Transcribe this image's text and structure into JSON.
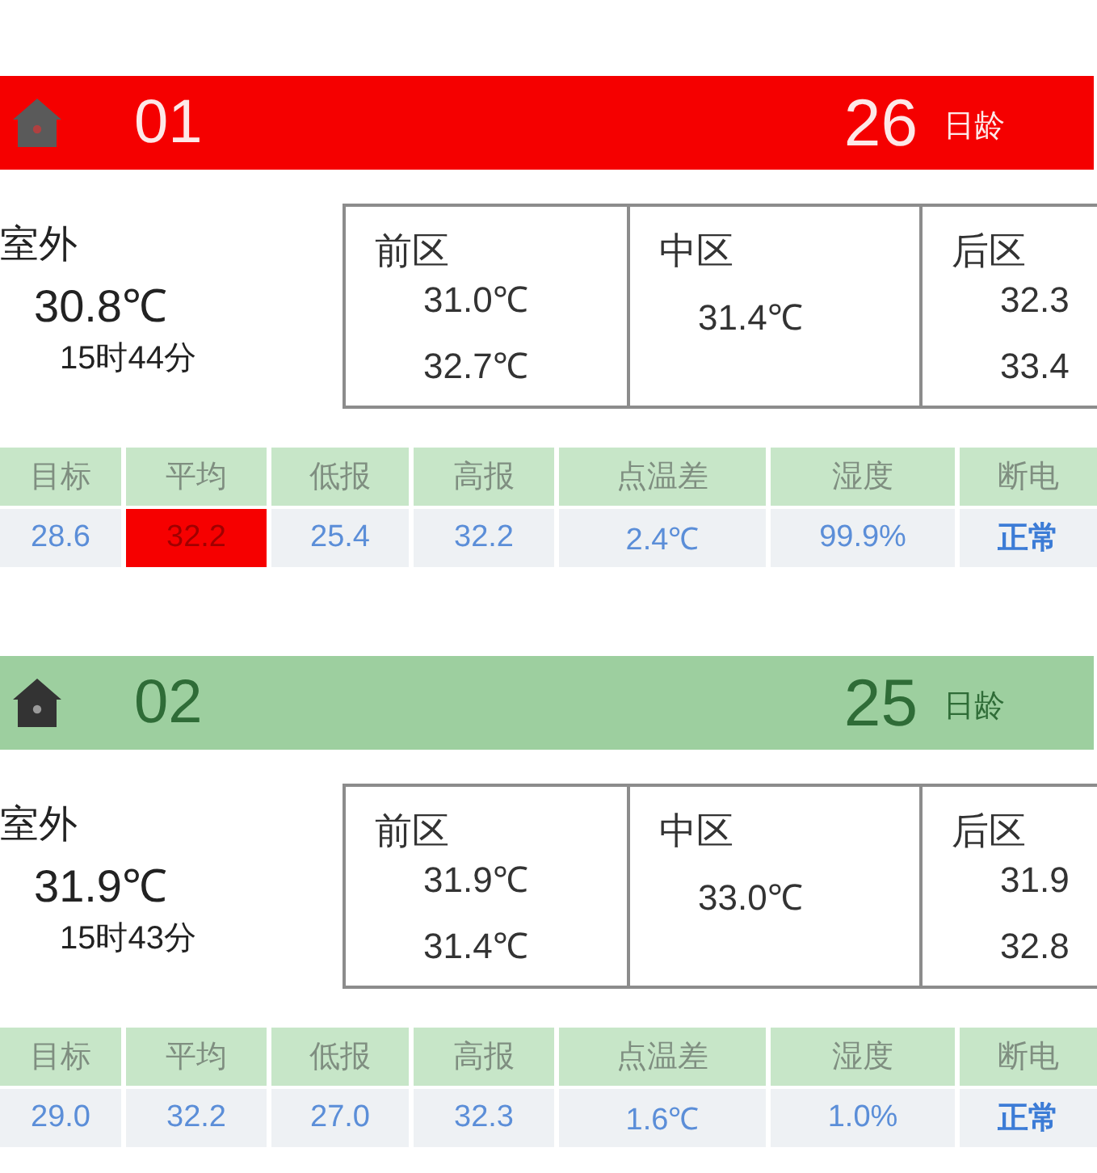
{
  "houses": [
    {
      "number": "01",
      "alarm": true,
      "age": "26",
      "age_unit": "日龄",
      "outdoor": {
        "label": "室外",
        "temperature": "30.8℃",
        "time": "15时44分"
      },
      "zones": [
        {
          "label": "前区",
          "readings": [
            "31.0℃",
            "32.7℃"
          ]
        },
        {
          "label": "中区",
          "readings": [
            "31.4℃"
          ]
        },
        {
          "label": "后区",
          "readings": [
            "32.3",
            "33.4"
          ]
        }
      ],
      "stats": [
        {
          "label": "目标",
          "value": "28.6",
          "kind": "number",
          "alarm": false
        },
        {
          "label": "平均",
          "value": "32.2",
          "kind": "number",
          "alarm": true
        },
        {
          "label": "低报",
          "value": "25.4",
          "kind": "number",
          "alarm": false
        },
        {
          "label": "高报",
          "value": "32.2",
          "kind": "number",
          "alarm": false
        },
        {
          "label": "点温差",
          "value": "2.4℃",
          "kind": "number",
          "alarm": false
        },
        {
          "label": "湿度",
          "value": "99.9%",
          "kind": "number",
          "alarm": false
        },
        {
          "label": "断电",
          "value": "正常",
          "kind": "status",
          "alarm": false
        }
      ]
    },
    {
      "number": "02",
      "alarm": false,
      "age": "25",
      "age_unit": "日龄",
      "outdoor": {
        "label": "室外",
        "temperature": "31.9℃",
        "time": "15时43分"
      },
      "zones": [
        {
          "label": "前区",
          "readings": [
            "31.9℃",
            "31.4℃"
          ]
        },
        {
          "label": "中区",
          "readings": [
            "33.0℃"
          ]
        },
        {
          "label": "后区",
          "readings": [
            "31.9",
            "32.8"
          ]
        }
      ],
      "stats": [
        {
          "label": "目标",
          "value": "29.0",
          "kind": "number",
          "alarm": false
        },
        {
          "label": "平均",
          "value": "32.2",
          "kind": "number",
          "alarm": false
        },
        {
          "label": "低报",
          "value": "27.0",
          "kind": "number",
          "alarm": false
        },
        {
          "label": "高报",
          "value": "32.3",
          "kind": "number",
          "alarm": false
        },
        {
          "label": "点温差",
          "value": "1.6℃",
          "kind": "number",
          "alarm": false
        },
        {
          "label": "湿度",
          "value": "1.0%",
          "kind": "number",
          "alarm": false
        },
        {
          "label": "断电",
          "value": "正常",
          "kind": "status",
          "alarm": false
        }
      ]
    }
  ]
}
